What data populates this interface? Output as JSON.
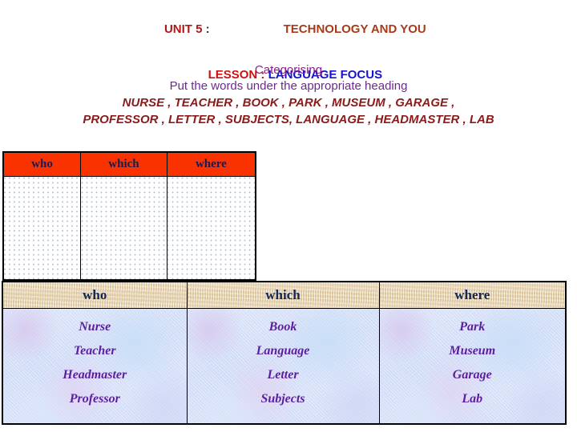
{
  "title": {
    "unit": "UNIT 5",
    "unit_colon": " :",
    "topic": "TECHNOLOGY AND YOU",
    "lesson": "LESSON :",
    "lesson_focus": " LANGUAGE FOCUS"
  },
  "instructions": {
    "heading": "Categorising",
    "subheading": "Put the words under the appropriate heading",
    "wordlist_line1": "NURSE , TEACHER , BOOK , PARK , MUSEUM , GARAGE ,",
    "wordlist_line2": "PROFESSOR , LETTER , SUBJECTS, LANGUAGE , HEADMASTER , LAB"
  },
  "empty_table": {
    "headers": [
      "who",
      "which",
      "where"
    ],
    "cells": [
      "",
      "",
      ""
    ]
  },
  "answer_table": {
    "headers": [
      "who",
      "which",
      "where"
    ],
    "columns": [
      {
        "words": [
          "Nurse",
          "Teacher",
          "Headmaster",
          "Professor"
        ]
      },
      {
        "words": [
          "Book",
          "Language",
          "Letter",
          "Subjects"
        ]
      },
      {
        "words": [
          "Park",
          "Museum",
          "Garage",
          "Lab"
        ]
      }
    ]
  },
  "colors": {
    "unit_red": "#b01818",
    "topic_red": "#a83a1a",
    "lesson_red": "#d01010",
    "focus_blue": "#1414c8",
    "instruction_purple": "#8b1a8b",
    "wordlist_maroon": "#8b1a1a",
    "header_orange": "#fa3200",
    "header_navy": "#1a1a4e",
    "answer_header_beige": "#e6d3ae",
    "answer_body_blue": "#d8e3f7",
    "answer_word_purple": "#5b1f9e"
  }
}
